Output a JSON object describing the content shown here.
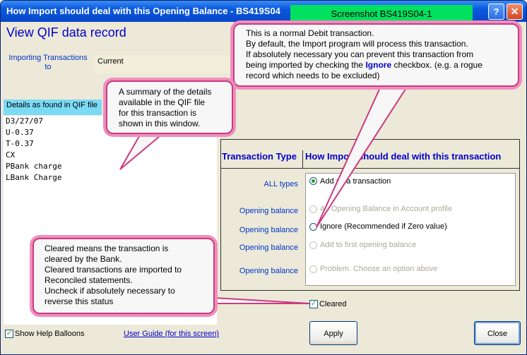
{
  "window": {
    "title": "How Import should deal with this Opening Balance - BS419S04",
    "screenshot_badge": "Screenshot BS419S04-1",
    "help_glyph": "?",
    "close_glyph": "✕"
  },
  "heading": "View QIF data record",
  "importing": {
    "label_line1": "Importing Transactions",
    "label_line2": "to",
    "value": "Current"
  },
  "qif": {
    "label": "Details as found in QIF file",
    "lines": [
      "D3/27/07",
      "U-0.37",
      "T-0.37",
      "CX",
      "PBank charge",
      "LBank Charge"
    ]
  },
  "transaction_table": {
    "type_header": "Transaction Type",
    "how_header": "How Import should deal with this transaction",
    "rows": [
      {
        "type": "ALL types",
        "option": "Add as a transaction",
        "selected": true,
        "disabled": false
      },
      {
        "type": "Opening balance",
        "option": "As Opening Balance in Account profile",
        "selected": false,
        "disabled": true
      },
      {
        "type": "Opening balance",
        "option": "Ignore (Recommended if Zero value)",
        "selected": false,
        "disabled": false
      },
      {
        "type": "Opening balance",
        "option": "Add to first opening balance",
        "selected": false,
        "disabled": true
      },
      {
        "type": "Opening balance",
        "option": "Problem. Choose an option above",
        "selected": false,
        "disabled": true
      }
    ]
  },
  "cleared": {
    "label": "Cleared",
    "checked": true
  },
  "show_help": {
    "label": "Show Help Balloons",
    "checked": true
  },
  "user_guide_link": "User Guide (for this screen)",
  "buttons": {
    "apply": "Apply",
    "close": "Close"
  },
  "balloons": {
    "debit": {
      "lines": [
        "This is a normal Debit transaction.",
        "By default, the Import program will process this transaction.",
        "If absolutely necessary you can prevent this transaction from",
        "being imported by checking the",
        "Ignore",
        "checkbox. (e.g. a rogue",
        "record which needs to be excluded)"
      ]
    },
    "summary": {
      "lines": [
        "A summary of the details",
        "available in the QIF file",
        "for this transaction is",
        "shown in this window."
      ]
    },
    "cleared": {
      "lines": [
        "Cleared means the transaction is",
        "cleared by the Bank.",
        "Cleared transactions are imported to",
        "Reconciled statements.",
        "Uncheck if absolutely necessary to",
        "reverse this status"
      ]
    }
  },
  "colors": {
    "title_bar": "#0a58de",
    "badge": "#00e060",
    "balloon_border": "#cc3a80",
    "link": "#0000cc",
    "qif_label_bg": "#7bdaf4"
  }
}
